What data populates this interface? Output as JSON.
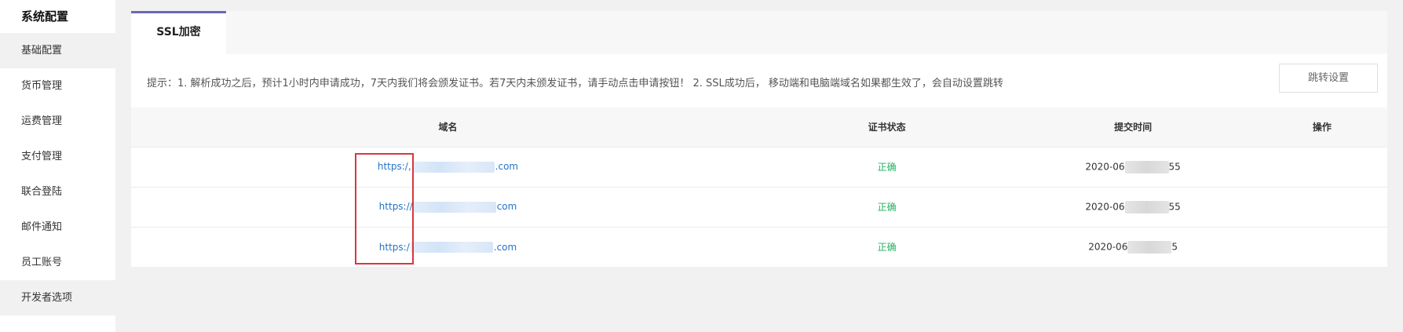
{
  "sidebar": {
    "title": "系统配置",
    "items": [
      {
        "label": "基础配置"
      },
      {
        "label": "货币管理"
      },
      {
        "label": "运费管理"
      },
      {
        "label": "支付管理"
      },
      {
        "label": "联合登陆"
      },
      {
        "label": "邮件通知"
      },
      {
        "label": "员工账号"
      },
      {
        "label": "开发者选项"
      }
    ]
  },
  "tabs": [
    {
      "label": "SSL加密"
    }
  ],
  "notice": "提示：1. 解析成功之后，预计1小时内申请成功，7天内我们将会颁发证书。若7天内未颁发证书，请手动点击申请按钮！ 2. SSL成功后， 移动端和电脑端域名如果都生效了，会自动设置跳转",
  "redirect_button": "跳转设置",
  "table": {
    "headers": [
      "域名",
      "证书状态",
      "提交时间",
      "操作"
    ],
    "rows": [
      {
        "domain_prefix": "https:/,",
        "domain_suffix": ".com",
        "status": "正确",
        "time_prefix": "2020-06",
        "time_suffix": "55"
      },
      {
        "domain_prefix": "https://",
        "domain_suffix": "com",
        "status": "正确",
        "time_prefix": "2020-06",
        "time_suffix": "55"
      },
      {
        "domain_prefix": "https:/",
        "domain_suffix": ".com",
        "status": "正确",
        "time_prefix": "2020-06",
        "time_suffix": "5"
      }
    ]
  },
  "colors": {
    "accent": "#6d68b3",
    "link": "#2673c6",
    "status_ok": "#22b35e",
    "highlight": "#d9363e"
  }
}
